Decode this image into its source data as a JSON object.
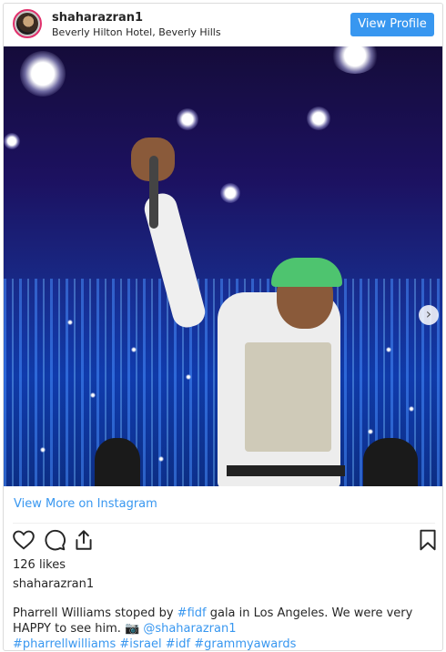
{
  "post": {
    "username": "shaharazran1",
    "location": "Beverly Hilton Hotel, Beverly Hills",
    "view_profile_label": "View Profile",
    "view_more_label": "View More on Instagram",
    "likes": "126 likes",
    "owner": "shaharazran1",
    "caption": {
      "part1": "Pharrell Williams stoped by ",
      "tag_fidf": "#fidf",
      "part2": " gala in Los Angeles. We were very HAPPY to see him. ",
      "camera": "📷",
      "mention": "@shaharazran1",
      "hashtags": [
        "#pharrellwilliams",
        "#israel",
        "#idf",
        "#grammyawards"
      ]
    }
  },
  "icons": {
    "heart": "heart-icon",
    "comment": "comment-icon",
    "share": "share-icon",
    "bookmark": "bookmark-icon",
    "next": "chevron-right-icon"
  },
  "colors": {
    "accent": "#3897f0",
    "text": "#262626",
    "border": "#dbdbdb"
  }
}
